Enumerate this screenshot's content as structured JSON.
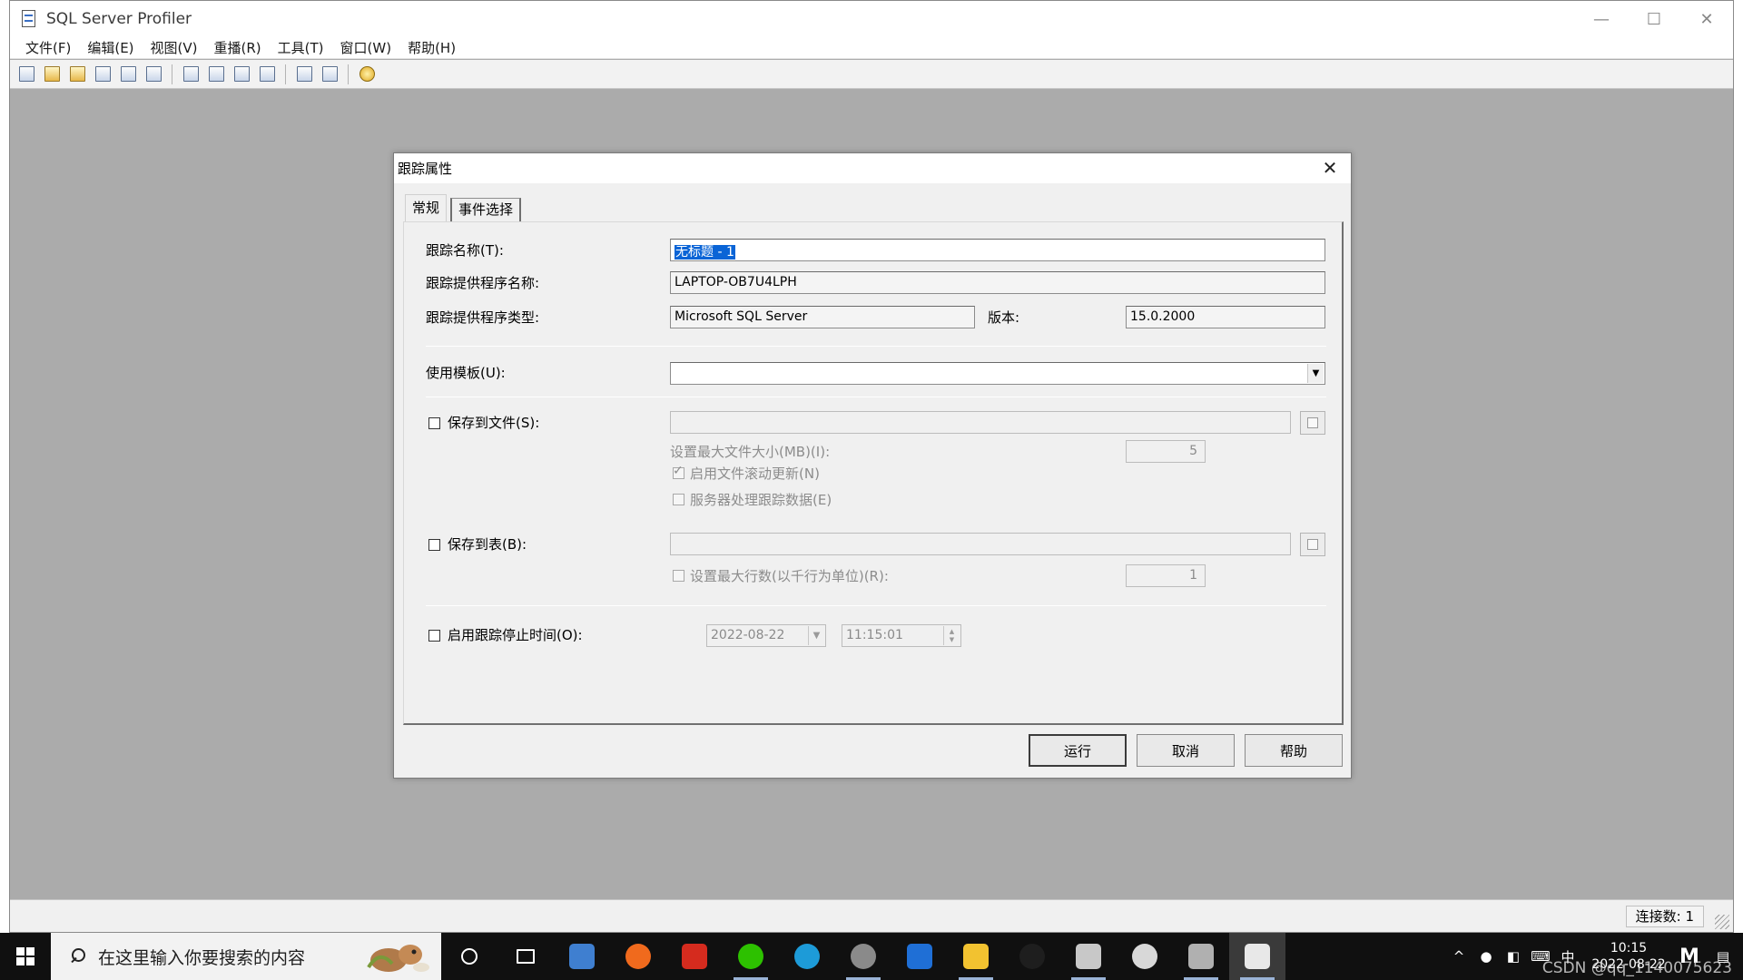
{
  "app": {
    "title": "SQL Server Profiler",
    "window_controls": {
      "minimize": "—",
      "maximize": "☐",
      "close": "✕"
    }
  },
  "menu": [
    {
      "label": "文件(F)"
    },
    {
      "label": "编辑(E)"
    },
    {
      "label": "视图(V)"
    },
    {
      "label": "重播(R)"
    },
    {
      "label": "工具(T)"
    },
    {
      "label": "窗口(W)"
    },
    {
      "label": "帮助(H)"
    }
  ],
  "toolbar": {
    "icons": [
      "new-trace-icon",
      "new-template-icon",
      "open-icon",
      "save-icon",
      "properties-icon",
      "find-icon",
      "copy-icon",
      "run-icon",
      "pause-icon",
      "stop-icon",
      "replay-icon",
      "chart-icon",
      "help-icon"
    ]
  },
  "dialog": {
    "title": "跟踪属性",
    "close": "✕",
    "tabs": [
      {
        "label": "常规",
        "active": true
      },
      {
        "label": "事件选择",
        "active": false
      }
    ],
    "trace_name_label": "跟踪名称(T):",
    "trace_name_value": "无标题 - 1",
    "provider_name_label": "跟踪提供程序名称:",
    "provider_name_value": "LAPTOP-OB7U4LPH",
    "provider_type_label": "跟踪提供程序类型:",
    "provider_type_value": "Microsoft SQL Server",
    "version_label": "版本:",
    "version_value": "15.0.2000",
    "template_label": "使用模板(U):",
    "template_value": "",
    "save_to_file_label": "保存到文件(S):",
    "save_to_file_checked": false,
    "max_file_size_label": "设置最大文件大小(MB)(I):",
    "max_file_size_value": "5",
    "enable_rollover_label": "启用文件滚动更新(N)",
    "enable_rollover_checked": true,
    "server_process_label": "服务器处理跟踪数据(E)",
    "server_process_checked": false,
    "save_to_table_label": "保存到表(B):",
    "save_to_table_checked": false,
    "max_rows_label": "设置最大行数(以千行为单位)(R):",
    "max_rows_checked": false,
    "max_rows_value": "1",
    "stop_time_label": "启用跟踪停止时间(O):",
    "stop_time_checked": false,
    "stop_date_value": "2022-08-22",
    "stop_time_value": "11:15:01",
    "buttons": {
      "run": "运行",
      "cancel": "取消",
      "help": "帮助"
    }
  },
  "status_bar": {
    "connections": "连接数: 1"
  },
  "taskbar": {
    "search_placeholder": "在这里输入你要搜索的内容",
    "clock_time": "10:15",
    "clock_date": "2022-08-22",
    "ime": "中",
    "notification_letter": "M",
    "watermark": "CSDN @qq_1140075623",
    "apps": [
      {
        "name": "cortana-icon",
        "color": "#101010"
      },
      {
        "name": "task-view-icon",
        "color": "#101010"
      },
      {
        "name": "navicat-icon",
        "color": "#3f7fd0"
      },
      {
        "name": "firefox-icon",
        "color": "#f06a1d"
      },
      {
        "name": "wps-icon",
        "color": "#d52b1e"
      },
      {
        "name": "wechat-icon",
        "color": "#2dc100"
      },
      {
        "name": "edge-icon",
        "color": "#1d9bd8"
      },
      {
        "name": "settings-gear-icon",
        "color": "#8a8a8a"
      },
      {
        "name": "media-player-icon",
        "color": "#1f6fd6"
      },
      {
        "name": "file-explorer-icon",
        "color": "#f2c230"
      },
      {
        "name": "qq-icon",
        "color": "#1e1e1e"
      },
      {
        "name": "tools-icon",
        "color": "#c8c8c8"
      },
      {
        "name": "settings-icon",
        "color": "#d8d8d8"
      },
      {
        "name": "recorder-icon",
        "color": "#b0b0b0"
      },
      {
        "name": "sql-profiler-icon",
        "color": "#e8e8e8"
      }
    ]
  }
}
